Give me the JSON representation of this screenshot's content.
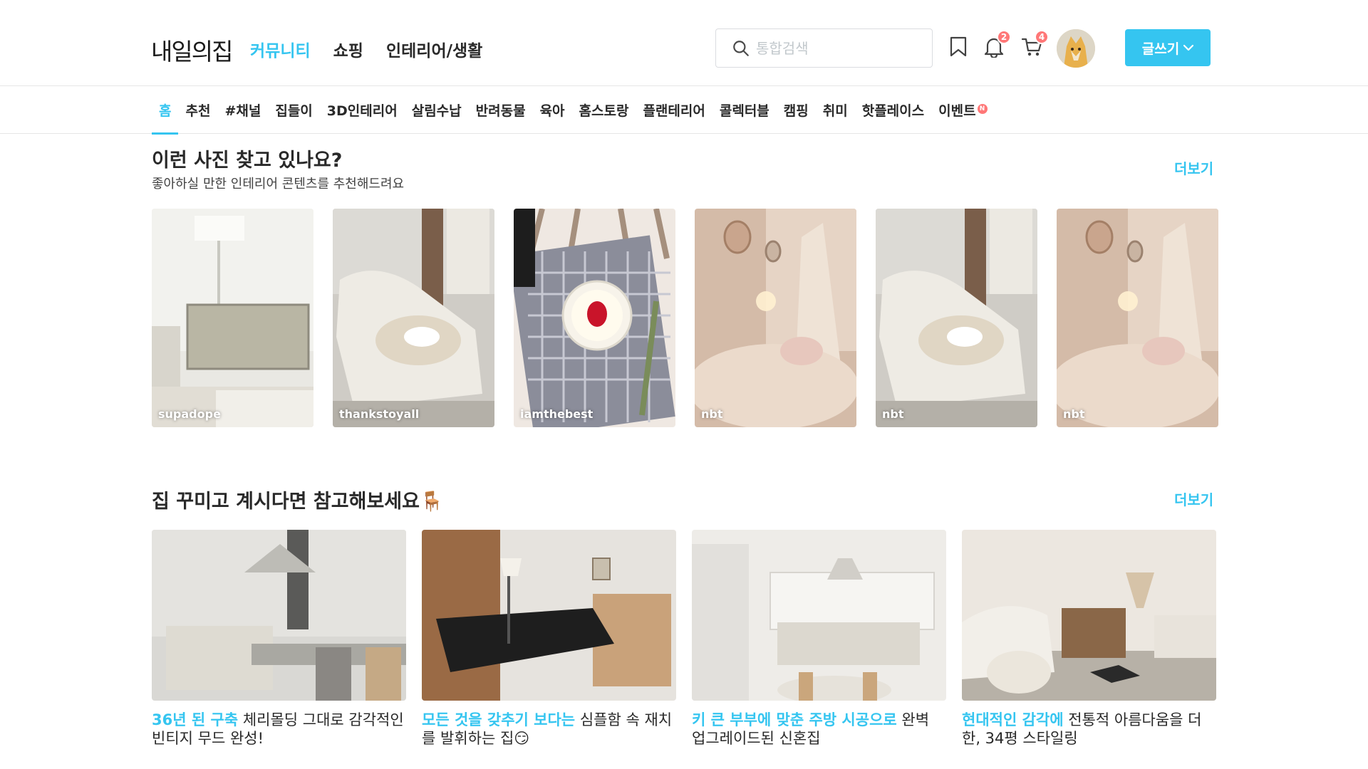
{
  "brand": {
    "logo_text": "내일의집",
    "accent": "#35c5f0"
  },
  "main_nav": [
    "커뮤니티",
    "쇼핑",
    "인테리어/생활"
  ],
  "search": {
    "placeholder": "통합검색"
  },
  "header_icons": {
    "bookmark": "bookmark-icon",
    "notification": {
      "icon": "bell-icon",
      "count": "2"
    },
    "cart": {
      "icon": "cart-icon",
      "count": "4"
    }
  },
  "write_button": {
    "label": "글쓰기"
  },
  "sub_nav": [
    "홈",
    "추천",
    "#채널",
    "집들이",
    "3D인테리어",
    "살림수납",
    "반려동물",
    "육아",
    "홈스토랑",
    "플랜테리어",
    "콜렉터블",
    "캠핑",
    "취미",
    "핫플레이스",
    "이벤트"
  ],
  "sub_nav_new_badge": "N",
  "section1": {
    "title": "이런 사진 찾고 있나요?",
    "subtitle": "좋아하실 만한 인테리어 콘텐츠를 추천해드려요",
    "more": "더보기",
    "photos": [
      {
        "user": "supadope"
      },
      {
        "user": "thankstoyall"
      },
      {
        "user": "iamthebest"
      },
      {
        "user": "nbt"
      },
      {
        "user": "nbt"
      },
      {
        "user": "nbt"
      }
    ]
  },
  "section2": {
    "title": "집 꾸미고 계시다면 참고해보세요🪑",
    "more": "더보기",
    "cards": [
      {
        "highlight": "36년 된 구축",
        "rest": " 체리몰딩 그대로 감각적인 빈티지 무드 완성!"
      },
      {
        "highlight": "모든 것을 갖추기 보다는",
        "rest": " 심플함 속 재치를 발휘하는 집😏"
      },
      {
        "highlight": "키 큰 부부에 맞춘 주방 시공으로",
        "rest": " 완벽 업그레이드된 신혼집"
      },
      {
        "highlight": "현대적인 감각에",
        "rest": " 전통적 아름다움을 더한, 34평 스타일링"
      }
    ]
  }
}
